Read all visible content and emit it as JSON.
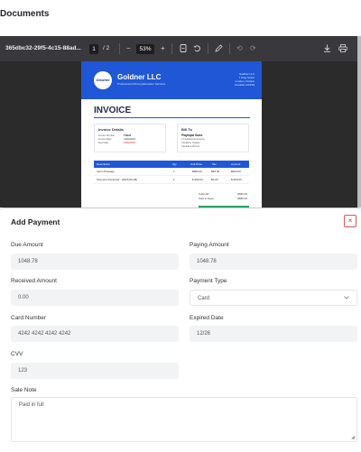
{
  "page": {
    "title": "Documents"
  },
  "viewer": {
    "file_name": "365dbc32-29f5-4c15-88ad...",
    "page_current": "1",
    "page_total": "/ 2",
    "zoom_out": "−",
    "zoom": "53%",
    "zoom_in": "+"
  },
  "invoice": {
    "logo_text": "Glodner",
    "company": "Goldner LLC",
    "tagline": "Professional Driving Education Services",
    "address": [
      "Goldner LLC",
      "7 King Street",
      "London, Ontario",
      "Canada L1K3S3"
    ],
    "title": "INVOICE",
    "details_title": "Invoice Details",
    "details": [
      {
        "label": "Invoice Number",
        "value": "TSB#8"
      },
      {
        "label": "Invoice Date",
        "value": "12/03/2024"
      },
      {
        "label": "Due Date",
        "value": "01/02/2025"
      }
    ],
    "billto_title": "Bill To",
    "billto_name": "Playtopia Sales",
    "billto_lines": [
      "17 Applecross Avenue",
      "Cornbine, Ontario",
      "Canada L3S 1G1"
    ],
    "columns": [
      "Description",
      "Qty",
      "Unit Price",
      "Tax",
      "Amount"
    ],
    "rows": [
      [
        "Swim Package",
        "1",
        "$980.00",
        "$68.00",
        "$600.00"
      ],
      [
        "Payment Received - (2025-09-09)",
        "1",
        "$-960.00",
        "$0.00",
        "$-600.00"
      ]
    ],
    "totals": [
      {
        "label": "Subtotal:",
        "value": "$580.00"
      },
      {
        "label": "Paid to Date:",
        "value": "$580.00"
      }
    ]
  },
  "modal": {
    "title": "Add Payment",
    "close_icon": "×",
    "due_amount_label": "Due Amount",
    "due_amount_value": "1048.78",
    "paying_amount_label": "Paying Amount",
    "paying_amount_value": "1048.78",
    "received_amount_label": "Received Amount",
    "received_amount_value": "0.00",
    "payment_type_label": "Payment Type",
    "payment_type_value": "Card",
    "card_number_label": "Card Number",
    "card_number_value": "4242 4242 4242 4242",
    "expired_date_label": "Expired Date",
    "expired_date_value": "12/26",
    "cvv_label": "CVV",
    "cvv_value": "123",
    "sale_note_label": "Sale Note",
    "sale_note_value": "Paid in full"
  },
  "colors": {
    "accent": "#1f57d6",
    "close": "#d22222",
    "toolbar": "#38383d"
  }
}
